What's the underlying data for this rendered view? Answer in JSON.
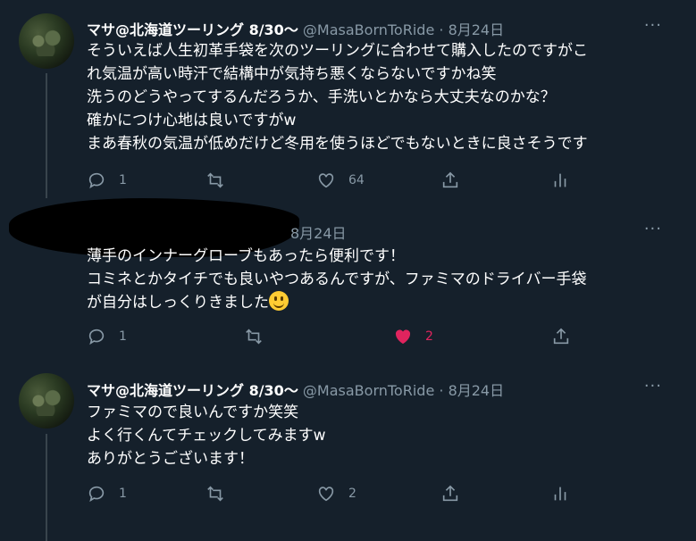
{
  "tweets": [
    {
      "name": "マサ@北海道ツーリング 8/30〜",
      "handle": "@MasaBornToRide",
      "sep": "·",
      "date": "8月24日",
      "lines": [
        "そういえば人生初革手袋を次のツーリングに合わせて購入したのですがこ",
        "れ気温が高い時汗で結構中が気持ち悪くならないですかね笑",
        "洗うのどうやってするんだろうか、手洗いとかなら大丈夫なのかな？",
        "確かにつけ心地は良いですがw",
        "まあ春秋の気温が低めだけど冬用を使うほどでもないときに良さそうです"
      ],
      "reply_count": "1",
      "retweet_count": "",
      "like_count": "64"
    },
    {
      "name": "",
      "handle": "",
      "date": "8月24日",
      "lines": [
        "薄手のインナーグローブもあったら便利です！",
        "コミネとかタイチでも良いやつあるんですが、ファミマのドライバー手袋",
        "が自分はしっくりきました"
      ],
      "reply_count": "1",
      "retweet_count": "",
      "like_count": "2",
      "liked": true
    },
    {
      "name": "マサ@北海道ツーリング 8/30〜",
      "handle": "@MasaBornToRide",
      "sep": "·",
      "date": "8月24日",
      "lines": [
        "ファミマので良いんですか笑笑",
        "よく行くんてチェックしてみますw",
        "ありがとうございます！"
      ],
      "reply_count": "1",
      "retweet_count": "",
      "like_count": "2"
    }
  ],
  "more_label": "···",
  "icons": {
    "reply": "reply-icon",
    "retweet": "retweet-icon",
    "like": "heart-icon",
    "share": "share-icon",
    "analytics": "analytics-icon"
  },
  "colors": {
    "background": "#15202b",
    "secondary_text": "#8899a6",
    "like_active": "#e0245e"
  }
}
